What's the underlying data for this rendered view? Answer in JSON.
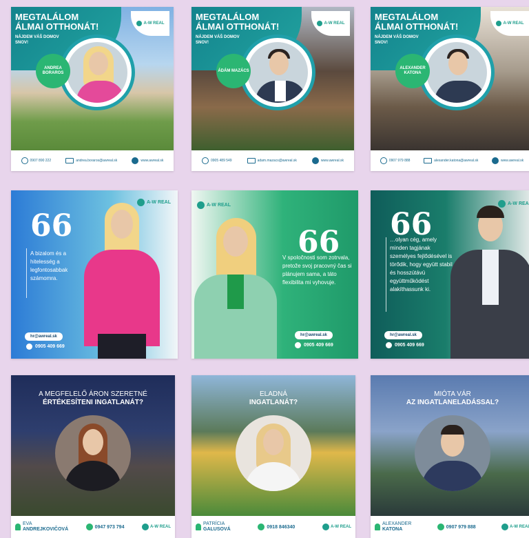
{
  "brand": {
    "logo_text": "A-W REAL",
    "accent": "#1f9e8c",
    "green": "#2bb673",
    "teal": "#13838d"
  },
  "row1": [
    {
      "headline1": "MEGTALÁLOM",
      "headline2": "ÁLMAI OTTHONÁT!",
      "sub": "NÁJDEM VÁŠ DOMOV SNOV!",
      "name": "ANDREA BORAROS",
      "phone": "0907 890 222",
      "email": "andrea.boraros@awreal.sk",
      "web": "www.awreal.sk"
    },
    {
      "headline1": "MEGTALÁLOM",
      "headline2": "ÁLMAI OTTHONÁT!",
      "sub": "NÁJDEM VÁŠ DOMOV SNOV!",
      "name": "ÁDÁM MAZÁCS",
      "phone": "0905 489 549",
      "email": "adam.mazacs@awreal.sk",
      "web": "www.awreal.sk"
    },
    {
      "headline1": "MEGTALÁLOM",
      "headline2": "ÁLMAI OTTHONÁT!",
      "sub": "NÁJDEM VÁŠ DOMOV SNOV!",
      "name": "ALEXANDER KATONA",
      "phone": "0907 979 888",
      "email": "alexander.katona@awreal.sk",
      "web": "www.awreal.sk"
    }
  ],
  "row2": [
    {
      "quote_mark": "66",
      "quote": "A bizalom és a hitelesség a legfontosabbak számomra.",
      "email": "hr@awreal.sk",
      "phone": "0905 409 669"
    },
    {
      "quote_mark": "66",
      "quote": "V spoločnosti som zotrvala, pretože svoj pracovný čas si plánujem sama, a táto flexibilita mi vyhovuje.",
      "email": "hr@awreal.sk",
      "phone": "0905 409 669"
    },
    {
      "quote_mark": "66",
      "quote": "…olyan cég, amely minden tagjának személyes fejlődésével is törődik, hogy együtt stabil és hosszútávú együttműködést alakíthassunk ki.",
      "email": "hr@awreal.sk",
      "phone": "0905 409 669"
    }
  ],
  "row3": [
    {
      "title1": "A MEGFELELŐ ÁRON SZERETNÉ",
      "title2": "ÉRTÉKESÍTENI INGATLANÁT?",
      "first": "EVA",
      "last": "ANDREJKOVIČOVÁ",
      "phone": "0947 973 794"
    },
    {
      "title1": "ELADNÁ",
      "title2": "INGATLANÁT?",
      "first": "PATRÍCIA",
      "last": "GALUSOVÁ",
      "phone": "0918 846340"
    },
    {
      "title1": "MIÓTA VÁR",
      "title2": "AZ INGATLANELADÁSSAL?",
      "first": "ALEXANDER",
      "last": "KATONA",
      "phone": "0907 979 888"
    }
  ]
}
